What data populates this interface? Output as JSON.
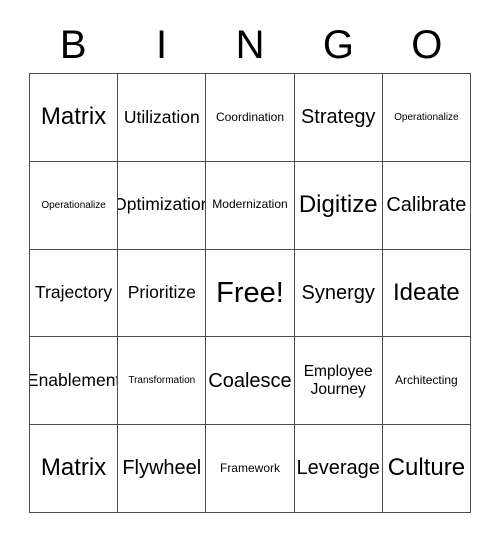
{
  "card": {
    "title": "BINGO",
    "header_letters": [
      "B",
      "I",
      "N",
      "G",
      "O"
    ],
    "grid_size": "5x5",
    "free_space_label": "Free!",
    "colors": {
      "background": "#ffffff",
      "text": "#000000",
      "grid_line": "#4d4d4d"
    },
    "rows": [
      [
        {
          "label": "Matrix",
          "size": "xl"
        },
        {
          "label": "Utilization",
          "size": "md"
        },
        {
          "label": "Coordination",
          "size": "xs"
        },
        {
          "label": "Strategy",
          "size": "lg"
        },
        {
          "label": "Operationalize",
          "size": "xxs"
        }
      ],
      [
        {
          "label": "Operationalize",
          "size": "xxs"
        },
        {
          "label": "Optimization",
          "size": "md"
        },
        {
          "label": "Modernization",
          "size": "xs"
        },
        {
          "label": "Digitize",
          "size": "xl"
        },
        {
          "label": "Calibrate",
          "size": "lg"
        }
      ],
      [
        {
          "label": "Trajectory",
          "size": "md"
        },
        {
          "label": "Prioritize",
          "size": "md"
        },
        {
          "label": "Free!",
          "size": "xxl"
        },
        {
          "label": "Synergy",
          "size": "lg"
        },
        {
          "label": "Ideate",
          "size": "xl"
        }
      ],
      [
        {
          "label": "Enablement",
          "size": "md"
        },
        {
          "label": "Transformation",
          "size": "xxs"
        },
        {
          "label": "Coalesce",
          "size": "lg"
        },
        {
          "label": "Employee\nJourney",
          "size": "sm"
        },
        {
          "label": "Architecting",
          "size": "xs"
        }
      ],
      [
        {
          "label": "Matrix",
          "size": "xl"
        },
        {
          "label": "Flywheel",
          "size": "lg"
        },
        {
          "label": "Framework",
          "size": "xs"
        },
        {
          "label": "Leverage",
          "size": "lg"
        },
        {
          "label": "Culture",
          "size": "xl"
        }
      ]
    ]
  }
}
